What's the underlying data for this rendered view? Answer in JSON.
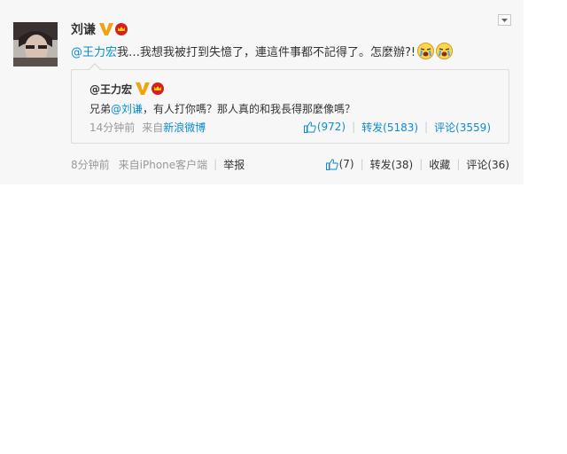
{
  "post": {
    "author": "刘谦",
    "mention": "@王力宏",
    "text": " 我…我想我被打到失憶了，連這件事都不記得了。怎麼辦?!",
    "emoji": [
      "crying-face-icon",
      "crying-face-icon"
    ],
    "time": "8分钟前",
    "source_prefix": "来自",
    "source": "iPhone客户端",
    "report": "举报",
    "likes": "(7)",
    "repost": "转发(38)",
    "favorite": "收藏",
    "comment": "评论(36)"
  },
  "quoted": {
    "author": "@王力宏",
    "text_prefix": "兄弟",
    "mention": "@刘谦",
    "text_suffix": "，有人打你嗎？那人真的和我長得那麼像嗎？",
    "time": "14分钟前",
    "source_prefix": "来自",
    "source": "新浪微博",
    "likes": "(972)",
    "repost": "转发(5183)",
    "comment": "评论(3559)"
  },
  "colors": {
    "link": "#0a8cd2",
    "meta": "#999999",
    "verified": "#f0a30a",
    "crown": "#d62020"
  }
}
